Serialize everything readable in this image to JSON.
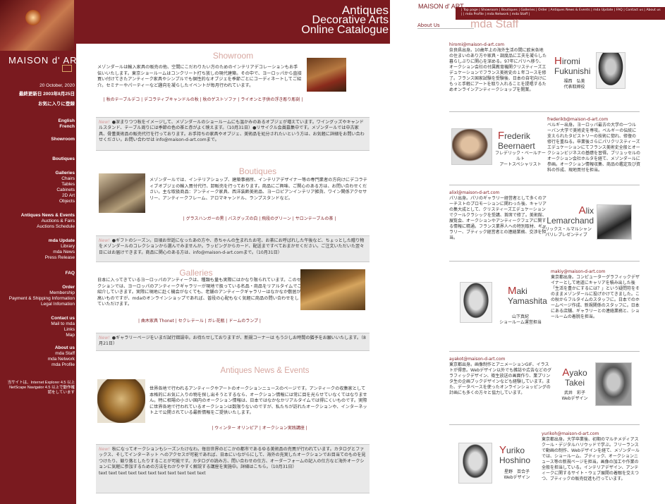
{
  "header": {
    "line1": "Antiques",
    "line2": "Decorative Arts",
    "line3": "Online Catalogue",
    "brand": "MAISON d' ART"
  },
  "sidebar": {
    "date": "20 October, 2020",
    "updated": "最終更新日 2003年8月25日",
    "favorite": "お気に入りに登録",
    "lang1": "English",
    "lang2": "French",
    "showroom": "Showroom",
    "boutiques": "Boutiques",
    "galleries": "Galleries",
    "g1": "Chairs",
    "g2": "Tables",
    "g3": "Cabinets",
    "g4": "2D Art",
    "g5": "Objects",
    "ane": "Antiques News & Events",
    "ane1": "Auctions & Fairs",
    "ane2": "Auctions Schedule",
    "mda": "mda Update",
    "mda1": "Library",
    "mda2": "mda News",
    "mda3": "Press Release",
    "faq": "FAQ",
    "order": "Order",
    "order1": "Membership",
    "order2": "Payment & Shipping Information",
    "order3": "Legal Infomation",
    "contact": "Contact us",
    "contact1": "Mail to mda",
    "contact2": "Links",
    "contact3": "Map",
    "about": "About us",
    "about1": "mda Staff",
    "about2": "mda Network",
    "about3": "mda Profile",
    "note": "当サイトは、Internet Explorer 4.5 以上 NetScape Navigator 4.5 以上で動作確認をしています"
  },
  "main": {
    "showroom_title": "Showroom",
    "showroom_text": "メゾンダールは輸入家具の販売の他、空間にこだわりたい方のためのインテリアデコレーションもお手伝いいたします。東京ショールームはコンクリート打ち放しの現代建築。その中で、ヨーロッパから直接買い付けてきたアンティーク家具やシンプルでも個性的なオブジェを季節ごとにコーディネートしてご紹介。セミナーやパーティーなど趣向を凝らしたイベントが毎月行われています。",
    "showroom_links": "| 秋のテーブルデコ | デコラティブキャンドルの秋 | 秋のゲストソファ | ライオンと子供の浮き彫り彫刻 |",
    "news1_tag": "New!",
    "news1": "●深まりつつ秋をイメージして、メゾンダールのショールームにも温かみのあるオブジェが増えています。ワイングッズやキャンドルスタンド、テーブル周りには季節の色の茶と赤がよく映えます。（10月31日）●リサイクル会員募集中です。メゾンダールでは中古家具、骨董美術品の販売代行を行っております。お手持ちの家具やオブジェ、美術品を処分されたいという方は、お気軽に詳細をお問い合わせください。お問い合わせは info@maison-d-art.comまで。",
    "boutiques_title": "Boutiques",
    "boutiques_text": "メゾンダールでは、インテリアショップ、建築事務所、インテリアデザイナー等の専門業者の方向けにデコラティブオブジェの輸入買付代行、卸販売を行っております。商品にご興味、ご関心のある方は、お問い合わせください。主な取扱商品：アンティーク家具、西洋装飾美術品、ヨーロピアンインテリア雑貨、ワイン関係アクセサリー、アンティークフレーム、アロマキャンドル、ランプスタンドなど。",
    "boutiques_links": "| グラスハンガーの黒 | バスグッズの白 | 飛段のグリーン | サロンテーブルの茶 |",
    "news2_tag": "New!",
    "news2": "●ギフトのシーズン。日頃お世話になったあの方や、赤ちゃんの生まれたお宅、お茶にお呼ばれした午後など、ちょっとした贈り物をメゾンダールのコレクションから選んでみませんか。ラッピングからカード、配送まですべておまかせください。ご注文いただいた翌々日にはお届けできます。商品に関心のある方は、info@maison-d-art.comまで。（10月31日）",
    "galleries_title": "Galleries",
    "galleries_text": "日本に入ってきているヨーロッパのアンティークは、種類も量も実際にはかなり限られています。このセクションでは、ヨーロッパのアンティークギャラリーが現地で扱っている名品・商品をリアルタイムでご紹介していきます。実際に現地に赴く機会がなくても、老舗のアンティークギャラリーはなかなか敷居が高いものですが、mdaのオンラインショップであれば、普段の心配もなく気軽に商品の問い合わせをしていただけます。",
    "galleries_links": "| 曲木家具 Thonet | セクレテール | ガレ花瓶 | ドームのランプ |",
    "news3_tag": "New!",
    "news3": "●ギャラリーページをいまだ試行錯誤中。お待たせしておりますが、新規コーナーは もう少しお時間の猶予をお願いいたします。（8月21日）",
    "ane_title": "Antiques News & Events",
    "ane_text": "世界各地で行われるアンティークやアートのオークションニュースのページです。アンティークの収集家として本格的にお気に入りの物を探し出そうとするなら、オークション情報には常に目を光らせていなくてはなりません。特に相場の小さい国内のオークション情報は、日本ではなかなかリアルタイムでは得にくいものです。実際に世界各地で行われているオークションは数限りないのですが、私たちが訪れたオークションや、インターネット上で公開されている最新情報をご提供いたします。",
    "ane_links": "| ウィンター オリンピア | オークション実践講座 |",
    "news4_tag": "New!",
    "news4": "秋になってオークションもシーズンたけなわ。毎日世界のどこかの都市であるゆる美術品の売買が行われています。カタログとファックス、そしてインターネット へのアクセスが可能であれば、日本にいながらにして、海外の充実したオークションでお目当てのものを見つけたり、競り落としたりすることが可能です。カタログの読み方、問い合わせの仕方、オーダーフォームの記入の仕方など海外オークションに気軽に参加するための方法をわかりやすく解説する講座を実施中。詳細はこちら。（10月31日）",
    "filler": "text text text text text text text text text text text"
  },
  "right": {
    "brand": "MAISON d' ART",
    "nav": "| Top page | Showroom | Boutiques | Galleries | Order | Antiques News & Events | mda Update | FAQ | Contact us | About us | | mda Profile | mda Network | mda Staff |",
    "about": "About Us",
    "title": "mda Staff",
    "staff": [
      {
        "mail": "hiromi@maison-d-art.com",
        "bio": "奈良県出身。10歳年上の海外生活の間に欧米各地の住まいのあり方や家具・調度品に工夫を凝らした暮らしぶりに関心を深める。97年にパリへ移り、オークション会社の付属教育機関クリスティーズエデュケーションでフランス美術史の１年コースを修了。フランス国家試験を受験後、日本の自宅向けにもっと手軽にアートを取り入れることを提唱するためオンラインアンティークショップを開業。",
        "first": "iromi",
        "first_cap": "H",
        "last": "Fukunishi",
        "jp": "福西　弘美",
        "role": "代表取締役"
      },
      {
        "mail": "frederikb@maison-d-art.com",
        "bio": "ベルギー出身。ヨーロッパ最古の大学の一つルーバン大学で美術史を専攻。ベルギーの伝統に支えられたタピストリーの技術に惚れ、修復の修行を重ねる。卒業後さらにパリクリスティーズエデュケーションにてフランス美術史全般とオークションビジネスの基礎を習得。ブリュッセルのオークション会社ホルタを経て、メゾンダールに参画。オークション情報収集、商品の鑑定及び資料の作成、現地買付を担当。",
        "first": "rederik",
        "first_cap": "F",
        "last": "Beernaert",
        "jp": "フレデリック・ベールナールト",
        "role": "アートスペシャリスト"
      },
      {
        "mail": "alixl@maison-d-art.com",
        "bio": "パリ出身。パリのギャラリー経営者として多くのアーチストのプロモーションに関わった後、キャリアの集大成として、クリスティーズエデュケーションでクールクラシックを受講、首席で修了。美術館、展覧会、オークションやアンティークフェアに関する情報に精通。フランス業界人への特別取材、ギャラリー、ブティック経営者との連絡業務、交渉を担当。",
        "first": "lix",
        "first_cap": "A",
        "last": "Lemarchand",
        "jp": "アリックス・ルマルシャン",
        "role": "パリレプレゼンティブ"
      },
      {
        "mail": "makiy@maison-d-art.com",
        "bio": "東京都出身。コンピューターグラフィックデザイナーとして地道にキャリアを積み出した後「生活を豊かにするには？」という疑問符をそのままメゾンダールに投げかけてきました。この秋からフルタイムのスタッフに。日本でのホームページ作成、新規関係のスタッフに。日本にある店舗、ギャラリーとの連絡業務と、ショールームの着脱を担当。",
        "first": "aki",
        "first_cap": "M",
        "last": "Yamashita",
        "jp": "山下真紀",
        "role": "ショールーム運営担当"
      },
      {
        "mail": "ayakot@maison-d-art.com",
        "bio": "東京都出身。画像制作とアニメーションGIF、イラストが得意。Webデザイン以外でも雑誌や広告などのグラフィックデザイン、衛生放送の画面作り、業プリンタ生の企画ブックデザインなども経験しています。また、データベースを使ったオンラインショッピングの計画にも多くの方々と協力しています。",
        "first": "yako",
        "first_cap": "A",
        "last": "Takei",
        "jp": "武井　彩子",
        "role": "Webデザイン"
      },
      {
        "mail": "yurikoh@maison-d-art.com",
        "bio": "東京都出身。大学卒業後、初期のマルチメディアスクール・デジタルハリウッドで学ぶ。フリーランスで動画の制作、Webデザインを経て、メゾンダールでは、ショールーム、ブティック、オークションニュース等の新規ページを担当。画像の加工や作業の全般を担当している。インテリアデザイン、アンティークに関するサイト・ウェブ展開の着眼を交えつつ、ブティックの販売促進も行っています。",
        "first": "uriko",
        "first_cap": "Y",
        "last": "Hoshino",
        "jp": "星野　百合子",
        "role": "Webデザイン"
      }
    ]
  }
}
